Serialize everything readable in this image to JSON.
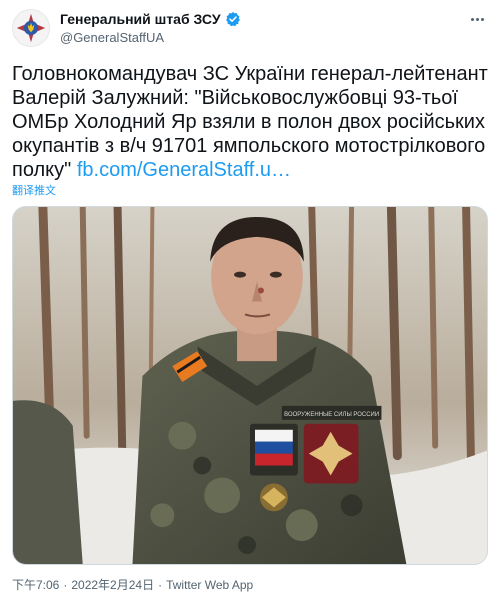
{
  "author": {
    "display_name": "Генеральний штаб ЗСУ",
    "handle": "@GeneralStaffUA"
  },
  "tweet": {
    "text": "Головнокомандувач ЗС України генерал-лейтенант Валерій Залужний: \"Військовослужбовці 93-тьої ОМБр Холодний Яр взяли в полон двох російських окупантів з в/ч 91701 ямпольского мотострілкового полку\" ",
    "link": "fb.com/GeneralStaff.u…",
    "translate_label": "翻译推文"
  },
  "photo": {
    "patch_text": "ВООРУЖЕННЫЕ СИЛЫ РОССИИ"
  },
  "meta": {
    "time": "下午7:06",
    "separator": "·",
    "date": "2022年2月24日",
    "source": "Twitter Web App"
  },
  "colors": {
    "accent": "#1d9bf0",
    "text": "#0f1419",
    "secondary": "#536471"
  },
  "icons": {
    "verified": "verified-badge-icon",
    "more": "more-options-icon",
    "avatar": "general-staff-emblem"
  }
}
